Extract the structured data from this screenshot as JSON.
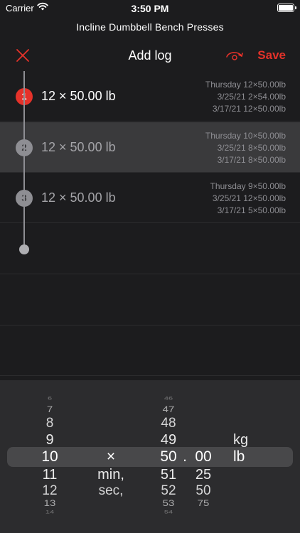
{
  "status_bar": {
    "carrier": "Carrier",
    "time": "3:50 PM"
  },
  "exercise_title": "Incline Dumbbell Bench Presses",
  "nav": {
    "title": "Add log",
    "save_label": "Save"
  },
  "colors": {
    "accent": "#e5322a",
    "background": "#1c1c1e",
    "selected_row": "#3a3a3c"
  },
  "sets": [
    {
      "number": "1",
      "value": "12 × 50.00 lb",
      "history": [
        "Thursday 12×50.00lb",
        "3/25/21 2×54.00lb",
        "3/17/21 12×50.00lb"
      ]
    },
    {
      "number": "2",
      "value": "12 × 50.00 lb",
      "history": [
        "Thursday 10×50.00lb",
        "3/25/21 8×50.00lb",
        "3/17/21 8×50.00lb"
      ]
    },
    {
      "number": "3",
      "value": "12 × 50.00 lb",
      "history": [
        "Thursday 9×50.00lb",
        "3/25/21 12×50.00lb",
        "3/17/21 5×50.00lb"
      ]
    }
  ],
  "picker": {
    "reps": [
      "6",
      "7",
      "8",
      "9",
      "10",
      "11",
      "12",
      "13",
      "14"
    ],
    "separator": [
      "×",
      "min,",
      "sec,"
    ],
    "weight_whole": [
      "46",
      "47",
      "48",
      "49",
      "50",
      "51",
      "52",
      "53",
      "54"
    ],
    "decimal_point": ".",
    "weight_fraction": [
      "00",
      "25",
      "50",
      "75"
    ],
    "units": [
      "kg",
      "lb"
    ]
  }
}
